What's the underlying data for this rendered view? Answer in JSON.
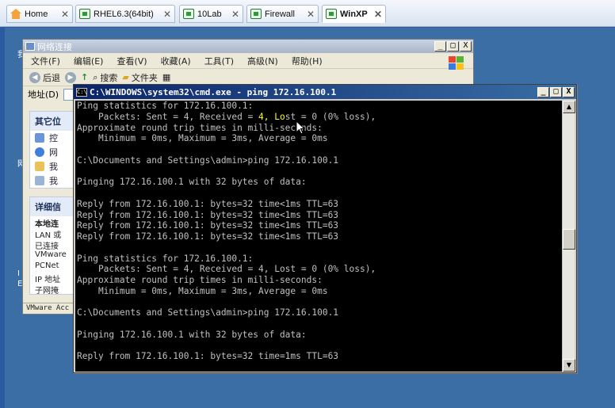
{
  "tabs": [
    {
      "label": "Home",
      "icon": "home-icon",
      "active": false
    },
    {
      "label": "RHEL6.3(64bit)",
      "icon": "vm-icon",
      "active": false
    },
    {
      "label": "10Lab",
      "icon": "vm-icon",
      "active": false
    },
    {
      "label": "Firewall",
      "icon": "vm-icon",
      "active": false
    },
    {
      "label": "WinXP",
      "icon": "vm-icon",
      "active": true
    }
  ],
  "tab_close_glyph": "✕",
  "desktop": {
    "side_letters": [
      "我",
      "网",
      "I",
      "E"
    ]
  },
  "netwin": {
    "title": "网络连接",
    "menu": [
      "文件(F)",
      "编辑(E)",
      "查看(V)",
      "收藏(A)",
      "工具(T)",
      "高级(N)",
      "帮助(H)"
    ],
    "toolbar": {
      "back": "后退",
      "search": "搜索",
      "folders": "文件夹"
    },
    "address_label": "地址(D)",
    "other_places_title": "其它位",
    "other_places": [
      "控",
      "网",
      "我",
      "我"
    ],
    "details_title": "详细信",
    "details_lines": [
      "本地连",
      "LAN 或",
      "已连接",
      "VMware",
      "PCNet",
      "IP 地址",
      "子网掩"
    ],
    "status": "VMware Acc"
  },
  "cmd": {
    "title": "C:\\WINDOWS\\system32\\cmd.exe - ping 172.16.100.1",
    "icon_text": "C:\\",
    "lines": [
      "Ping statistics for 172.16.100.1:",
      "    Packets: Sent = 4, Received = 4, Lost = 0 (0% loss),",
      "Approximate round trip times in milli-seconds:",
      "    Minimum = 0ms, Maximum = 3ms, Average = 0ms",
      "",
      "C:\\Documents and Settings\\admin>ping 172.16.100.1",
      "",
      "Pinging 172.16.100.1 with 32 bytes of data:",
      "",
      "Reply from 172.16.100.1: bytes=32 time<1ms TTL=63",
      "Reply from 172.16.100.1: bytes=32 time<1ms TTL=63",
      "Reply from 172.16.100.1: bytes=32 time<1ms TTL=63",
      "Reply from 172.16.100.1: bytes=32 time<1ms TTL=63",
      "",
      "Ping statistics for 172.16.100.1:",
      "    Packets: Sent = 4, Received = 4, Lost = 0 (0% loss),",
      "Approximate round trip times in milli-seconds:",
      "    Minimum = 0ms, Maximum = 3ms, Average = 0ms",
      "",
      "C:\\Documents and Settings\\admin>ping 172.16.100.1",
      "",
      "Pinging 172.16.100.1 with 32 bytes of data:",
      "",
      "Reply from 172.16.100.1: bytes=32 time=1ms TTL=63",
      ""
    ],
    "highlight": {
      "line": 1,
      "text": "4, Lo"
    },
    "scroll_up_glyph": "▲",
    "scroll_down_glyph": "▼"
  },
  "window_buttons": {
    "minimize": "_",
    "maximize": "□",
    "close": "X"
  },
  "colors": {
    "desktop_bg": "#3a6ea5",
    "console_bg": "#000000",
    "console_text": "#c0c0c0",
    "console_highlight": "#ffff00",
    "cmd_title_start": "#0a246a"
  }
}
